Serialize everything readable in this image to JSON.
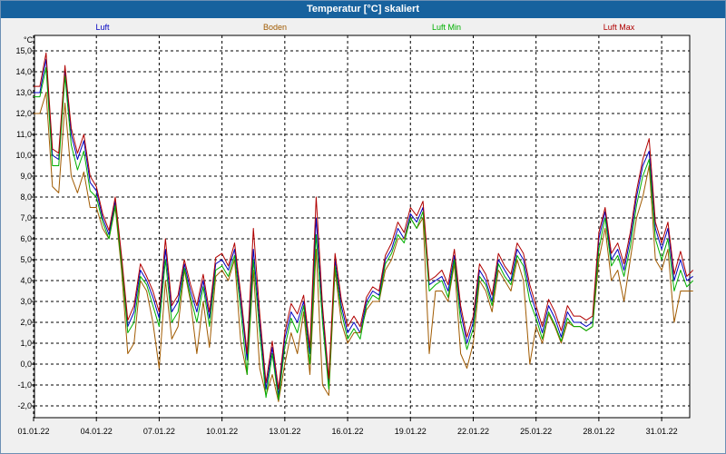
{
  "window": {
    "title": "Temperatur [°C] skaliert"
  },
  "chart_data": {
    "type": "line",
    "title": "Temperatur [°C] skaliert",
    "ylabel": "°C",
    "xlabel": "",
    "ylim": [
      -2.5,
      15.5
    ],
    "xlim": [
      0,
      31.6
    ],
    "y_ticks": [
      "15,0",
      "14,0",
      "13,0",
      "12,0",
      "11,0",
      "10,0",
      "9,0",
      "8,0",
      "7,0",
      "6,0",
      "5,0",
      "4,0",
      "3,0",
      "2,0",
      "1,0",
      "0,0",
      "-1,0",
      "-2,0"
    ],
    "x_ticks": [
      "01.01.22",
      "04.01.22",
      "07.01.22",
      "10.01.22",
      "13.01.22",
      "16.01.22",
      "19.01.22",
      "22.01.22",
      "25.01.22",
      "28.01.22",
      "31.01.22"
    ],
    "grid": true,
    "legend_position": "top",
    "x": [
      0,
      0.3,
      0.6,
      0.9,
      1.2,
      1.5,
      1.8,
      2.1,
      2.4,
      2.7,
      3,
      3.3,
      3.6,
      3.9,
      4.2,
      4.5,
      4.8,
      5.1,
      5.4,
      5.7,
      6,
      6.3,
      6.6,
      6.9,
      7.2,
      7.5,
      7.8,
      8.1,
      8.4,
      8.7,
      9,
      9.3,
      9.6,
      9.9,
      10.2,
      10.5,
      10.8,
      11.1,
      11.4,
      11.7,
      12,
      12.3,
      12.6,
      12.9,
      13.2,
      13.5,
      13.8,
      14.1,
      14.4,
      14.7,
      15,
      15.3,
      15.6,
      15.9,
      16.2,
      16.5,
      16.8,
      17.1,
      17.4,
      17.7,
      18,
      18.3,
      18.6,
      18.9,
      19.2,
      19.5,
      19.8,
      20.1,
      20.4,
      20.7,
      21,
      21.3,
      21.6,
      21.9,
      22.2,
      22.5,
      22.8,
      23.1,
      23.4,
      23.7,
      24,
      24.3,
      24.6,
      24.9,
      25.2,
      25.5,
      25.8,
      26.1,
      26.4,
      26.7,
      27,
      27.3,
      27.6,
      27.9,
      28.2,
      28.5,
      28.8,
      29.1,
      29.4,
      29.7,
      30,
      30.3,
      30.6,
      30.9,
      31.2,
      31.5
    ],
    "series": [
      {
        "name": "Luft",
        "color": "#0000c0",
        "values": [
          13.0,
          13.0,
          14.6,
          10.0,
          9.8,
          14.1,
          11.0,
          9.8,
          10.7,
          8.7,
          8.3,
          7.0,
          6.2,
          7.8,
          5.0,
          1.8,
          2.5,
          4.5,
          4.0,
          3.2,
          2.2,
          5.5,
          2.5,
          3.0,
          4.8,
          3.5,
          2.5,
          4.0,
          2.2,
          4.8,
          5.0,
          4.5,
          5.5,
          3.0,
          0.2,
          5.5,
          2.0,
          -1.2,
          0.8,
          -1.5,
          1.2,
          2.5,
          2.0,
          3.0,
          0.5,
          7.0,
          2.5,
          -1.0,
          5.0,
          2.8,
          1.5,
          2.0,
          1.5,
          3.0,
          3.5,
          3.3,
          5.0,
          5.5,
          6.5,
          6.0,
          7.2,
          6.8,
          7.5,
          3.8,
          4.0,
          4.2,
          3.5,
          5.2,
          2.5,
          1.0,
          2.0,
          4.5,
          4.0,
          3.0,
          5.0,
          4.5,
          4.0,
          5.5,
          5.0,
          3.5,
          2.5,
          1.5,
          2.8,
          2.2,
          1.3,
          2.5,
          2.0,
          2.0,
          1.8,
          2.0,
          6.0,
          7.3,
          5.0,
          5.5,
          4.5,
          6.0,
          8.0,
          9.5,
          10.2,
          6.5,
          5.5,
          6.5,
          4.0,
          5.0,
          4.0,
          4.2
        ]
      },
      {
        "name": "Boden",
        "color": "#a05a00",
        "values": [
          12.0,
          12.0,
          13.0,
          8.5,
          8.2,
          12.5,
          9.0,
          8.2,
          9.2,
          7.5,
          7.5,
          6.5,
          6.0,
          7.5,
          4.5,
          0.5,
          1.0,
          4.0,
          3.5,
          2.0,
          -0.2,
          4.0,
          1.2,
          1.8,
          4.5,
          3.0,
          0.5,
          3.0,
          0.8,
          4.2,
          4.5,
          4.0,
          5.0,
          1.0,
          -0.5,
          4.5,
          -0.2,
          -1.5,
          -0.5,
          -1.8,
          0.0,
          1.5,
          0.5,
          2.5,
          -0.5,
          5.5,
          -1.0,
          -1.5,
          4.5,
          2.0,
          1.0,
          1.5,
          1.5,
          2.6,
          3.0,
          3.0,
          4.5,
          5.0,
          6.0,
          6.0,
          7.0,
          6.5,
          7.0,
          0.5,
          3.5,
          3.5,
          3.0,
          4.8,
          0.5,
          -0.2,
          1.0,
          4.0,
          3.5,
          2.5,
          4.5,
          4.0,
          3.5,
          5.0,
          4.0,
          0.0,
          1.8,
          1.0,
          2.4,
          1.8,
          1.0,
          2.0,
          1.8,
          1.8,
          1.6,
          1.8,
          5.0,
          6.5,
          4.0,
          4.5,
          3.0,
          5.0,
          7.0,
          8.0,
          9.5,
          5.0,
          4.5,
          5.5,
          2.0,
          3.5,
          3.5,
          3.5
        ]
      },
      {
        "name": "Luft Min",
        "color": "#00b000",
        "values": [
          12.8,
          12.8,
          14.2,
          9.5,
          9.5,
          13.8,
          10.5,
          9.3,
          10.2,
          8.3,
          8.0,
          6.8,
          6.0,
          7.6,
          4.8,
          1.5,
          2.0,
          4.2,
          3.8,
          2.8,
          1.8,
          5.0,
          2.0,
          2.5,
          4.6,
          3.2,
          2.0,
          3.7,
          1.8,
          4.5,
          4.7,
          4.2,
          5.2,
          2.5,
          -0.5,
          5.0,
          1.5,
          -1.6,
          0.5,
          -1.7,
          0.8,
          2.2,
          1.5,
          2.8,
          0.0,
          6.2,
          2.0,
          -1.2,
          4.7,
          2.5,
          1.2,
          1.7,
          1.2,
          2.8,
          3.3,
          3.1,
          4.8,
          5.3,
          6.2,
          5.8,
          7.0,
          6.5,
          7.3,
          3.5,
          3.8,
          4.0,
          3.2,
          5.0,
          2.0,
          0.7,
          1.7,
          4.2,
          3.8,
          2.8,
          4.8,
          4.2,
          3.8,
          5.2,
          4.7,
          3.0,
          2.2,
          1.2,
          2.5,
          1.9,
          1.1,
          2.2,
          1.8,
          1.8,
          1.6,
          1.8,
          5.5,
          7.0,
          4.7,
          5.2,
          4.2,
          5.6,
          7.6,
          9.0,
          9.8,
          6.0,
          5.0,
          6.0,
          3.5,
          4.5,
          3.7,
          4.0
        ]
      },
      {
        "name": "Luft Max",
        "color": "#b00000",
        "values": [
          13.3,
          13.3,
          14.9,
          10.3,
          10.1,
          14.3,
          11.3,
          10.1,
          11.0,
          9.0,
          8.5,
          7.2,
          6.4,
          8.0,
          5.2,
          2.1,
          2.8,
          4.8,
          4.2,
          3.5,
          2.5,
          6.0,
          2.8,
          3.3,
          5.0,
          3.8,
          2.8,
          4.3,
          2.5,
          5.1,
          5.3,
          4.7,
          5.8,
          3.3,
          0.5,
          6.5,
          2.4,
          -0.9,
          1.1,
          -1.2,
          1.5,
          2.9,
          2.4,
          3.3,
          0.8,
          8.0,
          2.8,
          -0.7,
          5.3,
          3.1,
          1.8,
          2.3,
          1.8,
          3.2,
          3.7,
          3.5,
          5.2,
          5.8,
          6.8,
          6.3,
          7.5,
          7.1,
          7.8,
          4.0,
          4.2,
          4.5,
          3.8,
          5.5,
          2.8,
          1.3,
          2.3,
          4.8,
          4.3,
          3.3,
          5.3,
          4.7,
          4.3,
          5.8,
          5.3,
          3.8,
          2.8,
          1.8,
          3.1,
          2.5,
          1.6,
          2.8,
          2.3,
          2.3,
          2.1,
          2.3,
          6.3,
          7.5,
          5.3,
          5.8,
          4.8,
          6.3,
          8.3,
          9.8,
          10.8,
          6.8,
          5.8,
          6.8,
          4.3,
          5.4,
          4.2,
          4.5
        ]
      }
    ]
  }
}
